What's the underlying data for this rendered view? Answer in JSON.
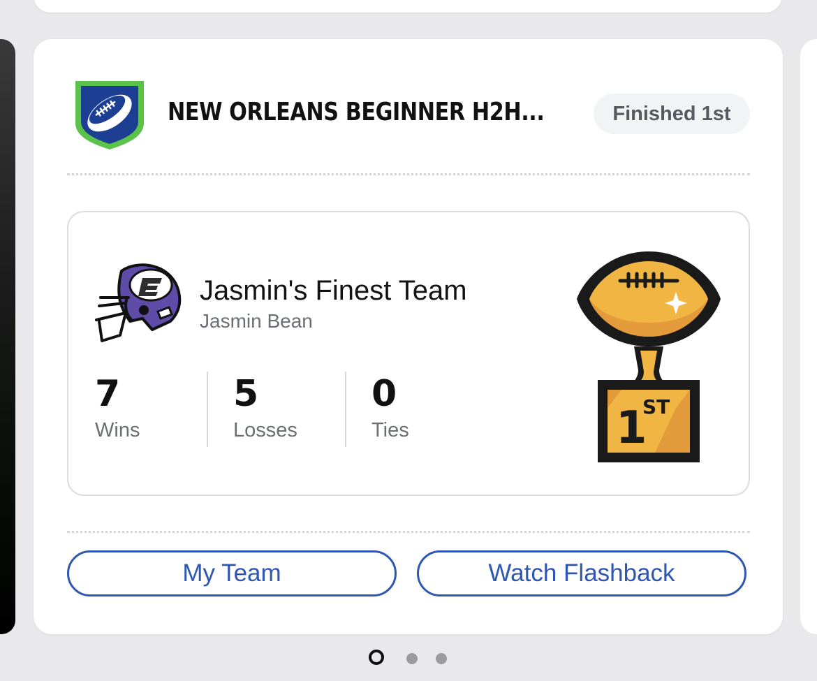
{
  "league": {
    "title": "NEW ORLEANS BEGINNER H2H...",
    "status": "Finished 1st",
    "logo_icon": "football-shield-icon"
  },
  "team": {
    "name": "Jasmin's Finest Team",
    "owner": "Jasmin Bean",
    "helmet_icon": "espn-helmet-icon",
    "stats": [
      {
        "value": "7",
        "label": "Wins"
      },
      {
        "value": "5",
        "label": "Losses"
      },
      {
        "value": "0",
        "label": "Ties"
      }
    ],
    "trophy": {
      "icon": "football-trophy-icon",
      "place_number": "1",
      "place_suffix": "ST"
    }
  },
  "actions": {
    "my_team": "My Team",
    "watch_flashback": "Watch Flashback"
  },
  "pagination": {
    "current": 1,
    "total": 3
  },
  "colors": {
    "accent": "#2f56b1",
    "shield_blue": "#1c3f94",
    "shield_green": "#5bc24a",
    "helmet_purple": "#5f4ba8",
    "trophy_gold": "#f0b542"
  }
}
